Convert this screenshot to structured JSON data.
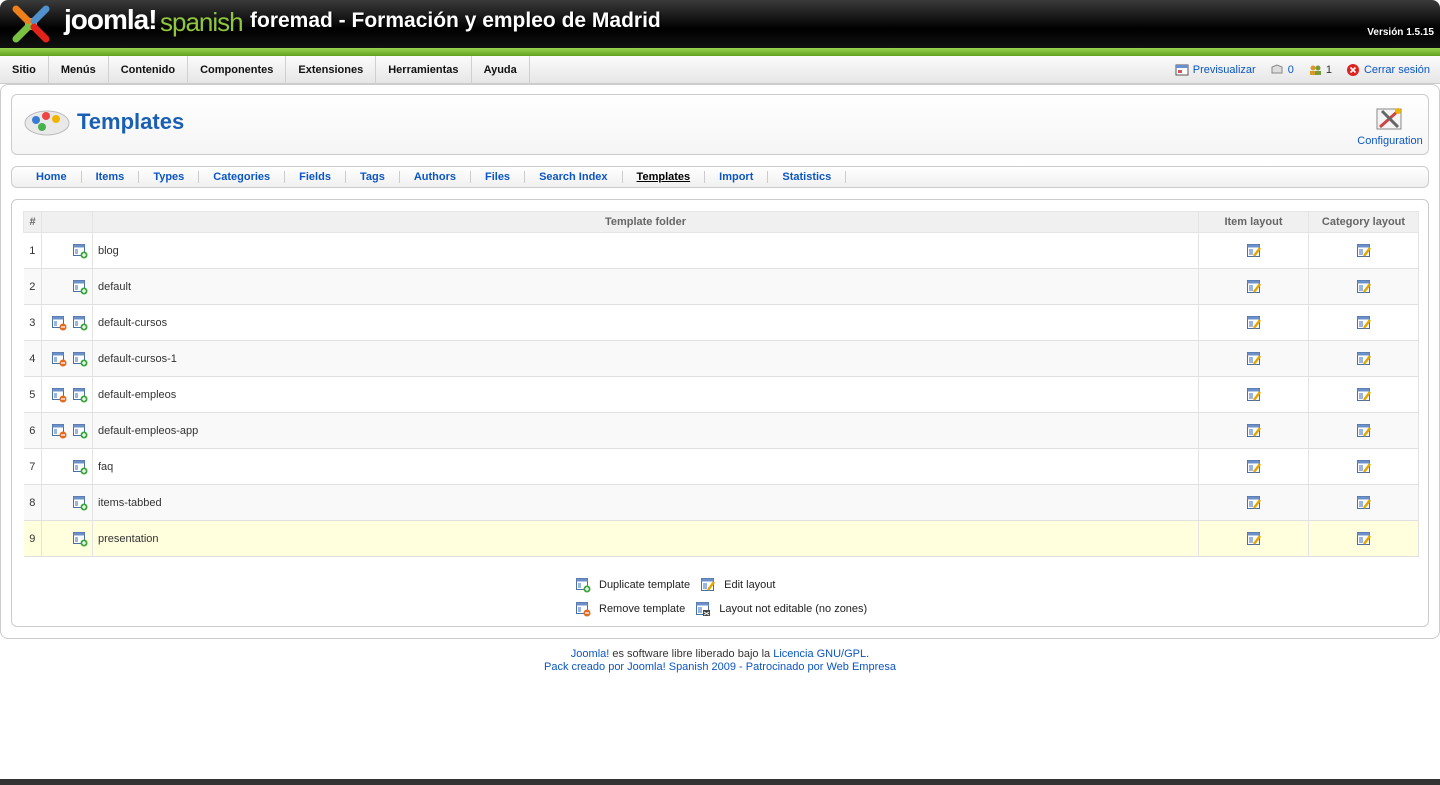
{
  "header": {
    "logo_text": "joomla!",
    "logo_sub": "spanish",
    "site_title": "foremad - Formación y empleo de Madrid",
    "version": "Versión 1.5.15"
  },
  "menu": {
    "items": [
      "Sitio",
      "Menús",
      "Contenido",
      "Componentes",
      "Extensiones",
      "Herramientas",
      "Ayuda"
    ]
  },
  "status": {
    "preview": "Previsualizar",
    "messages": "0",
    "users": "1",
    "logout": "Cerrar sesión"
  },
  "toolbar": {
    "title": "Templates",
    "config_label": "Configuration"
  },
  "submenu": {
    "items": [
      "Home",
      "Items",
      "Types",
      "Categories",
      "Fields",
      "Tags",
      "Authors",
      "Files",
      "Search Index",
      "Templates",
      "Import",
      "Statistics"
    ],
    "active": "Templates"
  },
  "table": {
    "headers": {
      "num": "#",
      "folder": "Template folder",
      "item_layout": "Item layout",
      "category_layout": "Category layout"
    },
    "rows": [
      {
        "num": "1",
        "folder": "blog",
        "removable": false
      },
      {
        "num": "2",
        "folder": "default",
        "removable": false
      },
      {
        "num": "3",
        "folder": "default-cursos",
        "removable": true
      },
      {
        "num": "4",
        "folder": "default-cursos-1",
        "removable": true
      },
      {
        "num": "5",
        "folder": "default-empleos",
        "removable": true
      },
      {
        "num": "6",
        "folder": "default-empleos-app",
        "removable": true
      },
      {
        "num": "7",
        "folder": "faq",
        "removable": false
      },
      {
        "num": "8",
        "folder": "items-tabbed",
        "removable": false
      },
      {
        "num": "9",
        "folder": "presentation",
        "removable": false
      }
    ]
  },
  "legend": {
    "duplicate": "Duplicate template",
    "edit": "Edit layout",
    "remove": "Remove template",
    "not_editable": "Layout not editable (no zones)"
  },
  "footer": {
    "joomla_link": "Joomla!",
    "text1": " es software libre liberado bajo la ",
    "license_link": "Licencia GNU/GPL",
    "text1_end": ".",
    "line2": "Pack creado por Joomla! Spanish 2009 - Patrocinado por Web Empresa"
  }
}
